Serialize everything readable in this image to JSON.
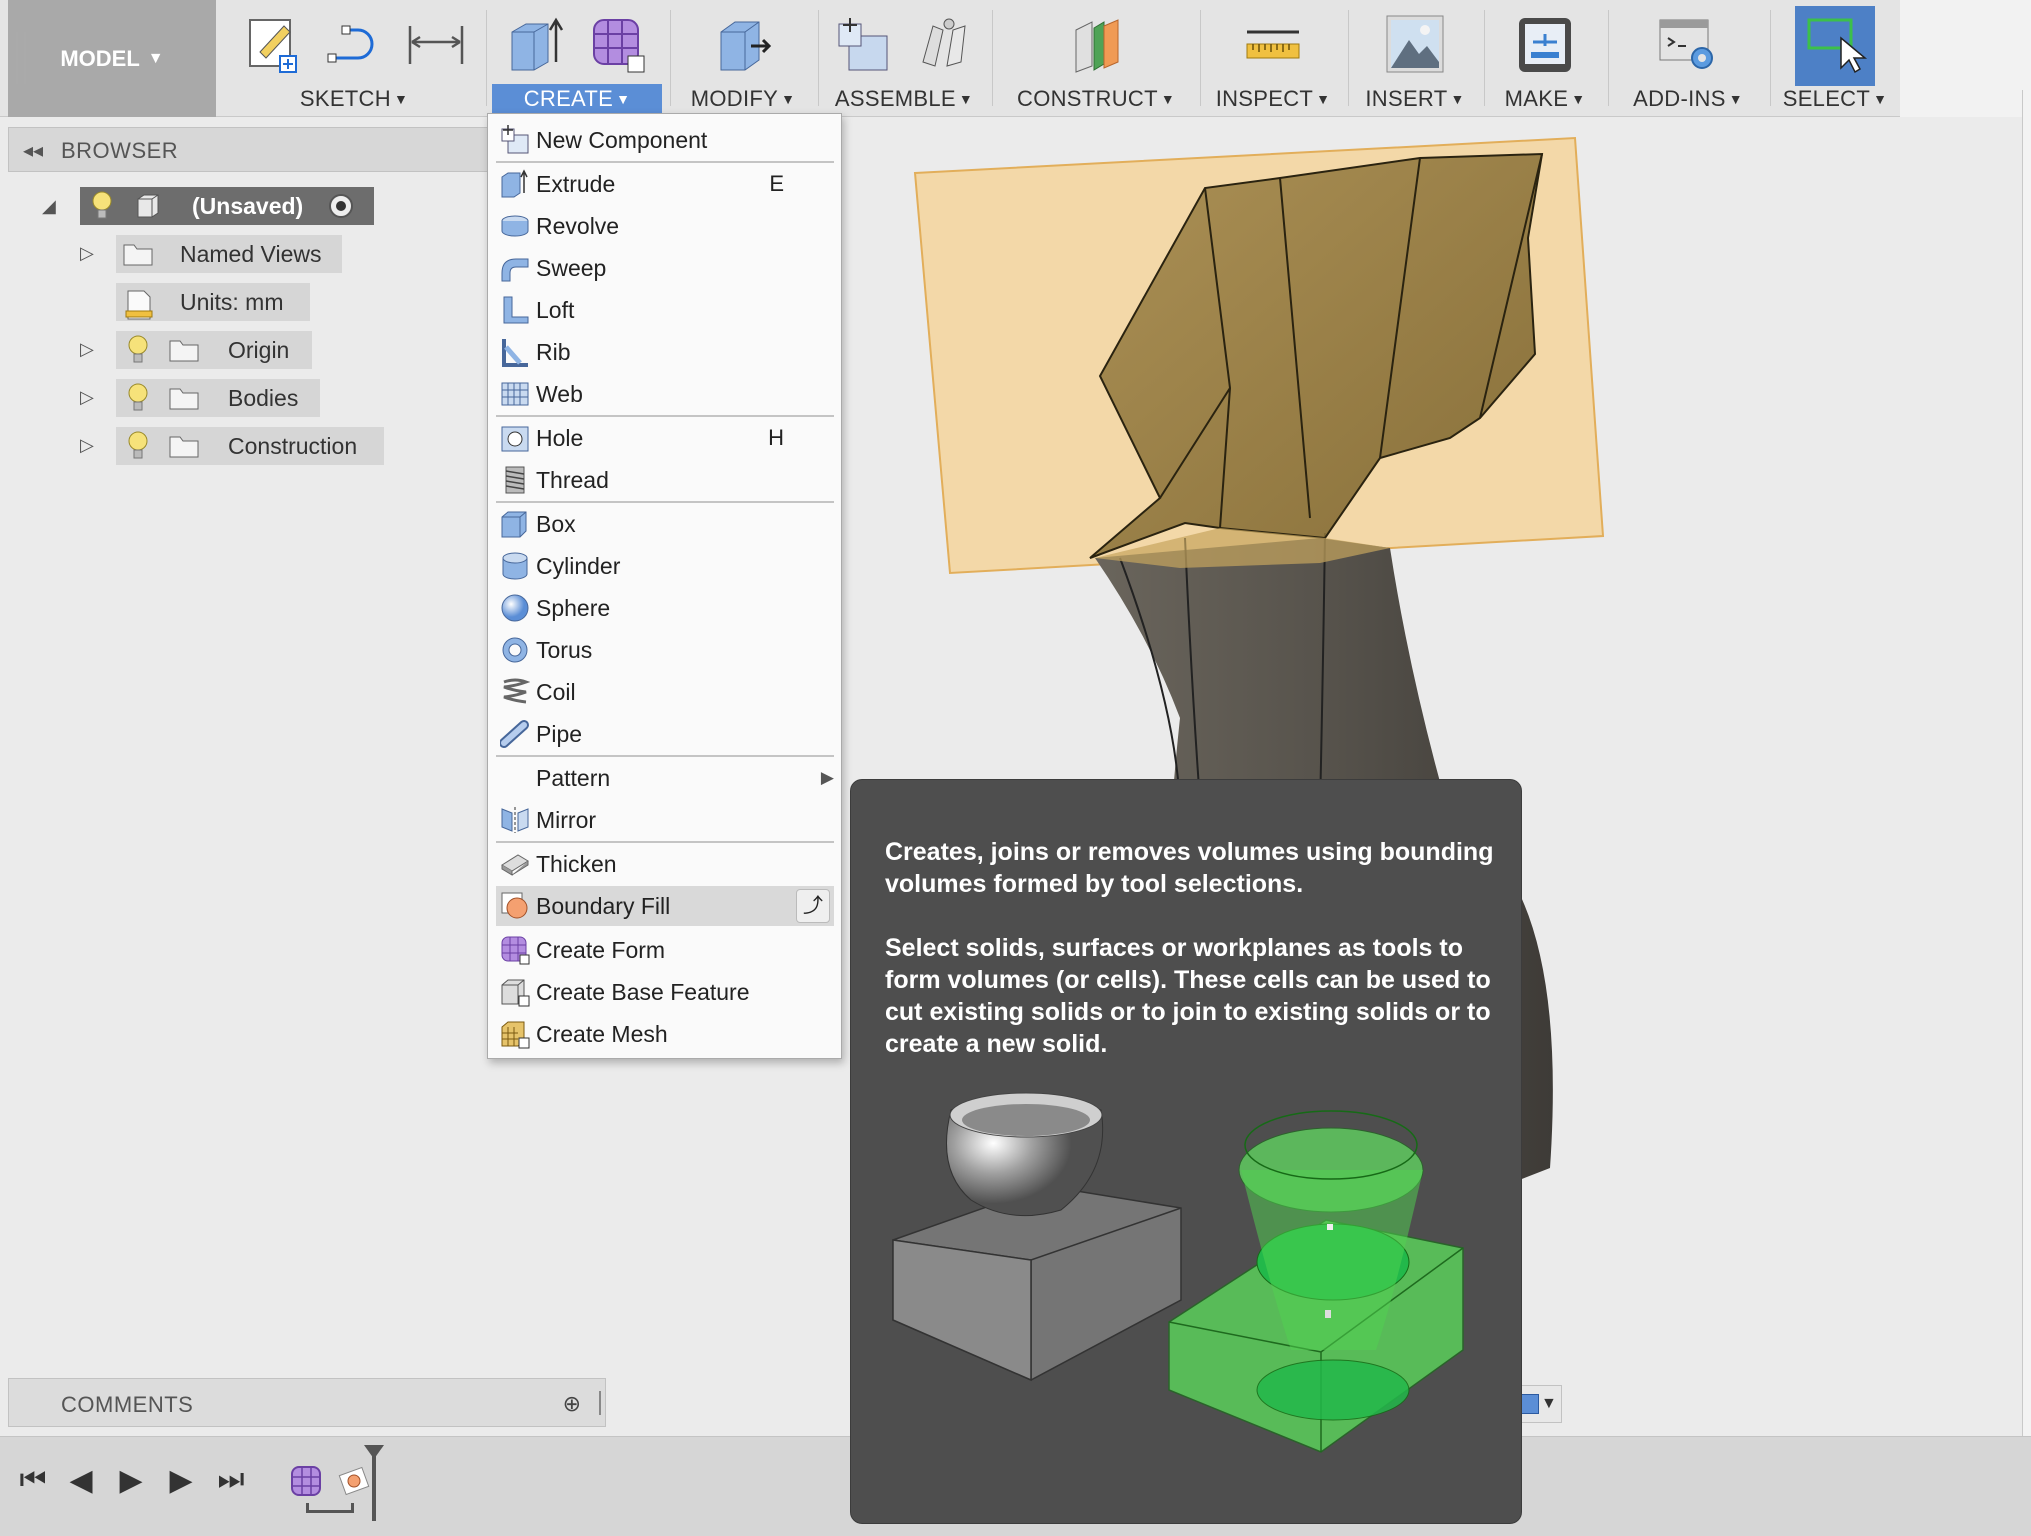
{
  "toolbar": {
    "workspace": "MODEL",
    "groups": [
      {
        "label": "SKETCH"
      },
      {
        "label": "CREATE"
      },
      {
        "label": "MODIFY"
      },
      {
        "label": "ASSEMBLE"
      },
      {
        "label": "CONSTRUCT"
      },
      {
        "label": "INSPECT"
      },
      {
        "label": "INSERT"
      },
      {
        "label": "MAKE"
      },
      {
        "label": "ADD-INS"
      },
      {
        "label": "SELECT"
      }
    ],
    "active_color": "#5b8ed6"
  },
  "browser": {
    "title": "BROWSER",
    "root": "(Unsaved)",
    "items": [
      {
        "label": "Named Views"
      },
      {
        "label": "Units: mm"
      },
      {
        "label": "Origin"
      },
      {
        "label": "Bodies"
      },
      {
        "label": "Construction"
      }
    ]
  },
  "menu": {
    "items": [
      {
        "label": "New Component",
        "icon": "component-icon"
      },
      {
        "label": "Extrude",
        "shortcut": "E",
        "icon": "extrude-icon"
      },
      {
        "label": "Revolve",
        "icon": "revolve-icon"
      },
      {
        "label": "Sweep",
        "icon": "sweep-icon"
      },
      {
        "label": "Loft",
        "icon": "loft-icon"
      },
      {
        "label": "Rib",
        "icon": "rib-icon"
      },
      {
        "label": "Web",
        "icon": "web-icon"
      },
      {
        "label": "Hole",
        "shortcut": "H",
        "icon": "hole-icon"
      },
      {
        "label": "Thread",
        "icon": "thread-icon"
      },
      {
        "label": "Box",
        "icon": "box-icon"
      },
      {
        "label": "Cylinder",
        "icon": "cylinder-icon"
      },
      {
        "label": "Sphere",
        "icon": "sphere-icon"
      },
      {
        "label": "Torus",
        "icon": "torus-icon"
      },
      {
        "label": "Coil",
        "icon": "coil-icon"
      },
      {
        "label": "Pipe",
        "icon": "pipe-icon"
      },
      {
        "label": "Pattern",
        "icon": "none"
      },
      {
        "label": "Mirror",
        "icon": "mirror-icon"
      },
      {
        "label": "Thicken",
        "icon": "thicken-icon"
      },
      {
        "label": "Boundary Fill",
        "icon": "boundary-fill-icon"
      },
      {
        "label": "Create Form",
        "icon": "form-icon"
      },
      {
        "label": "Create Base Feature",
        "icon": "base-feature-icon"
      },
      {
        "label": "Create Mesh",
        "icon": "mesh-icon"
      }
    ]
  },
  "tooltip": {
    "para1": "Creates, joins or removes volumes using bounding volumes formed by tool selections.",
    "para2": "Select solids, surfaces or workplanes as tools to form volumes (or cells). These cells can be used to cut existing solids or to join to existing solids or to create a new solid."
  },
  "comments": {
    "title": "COMMENTS"
  }
}
